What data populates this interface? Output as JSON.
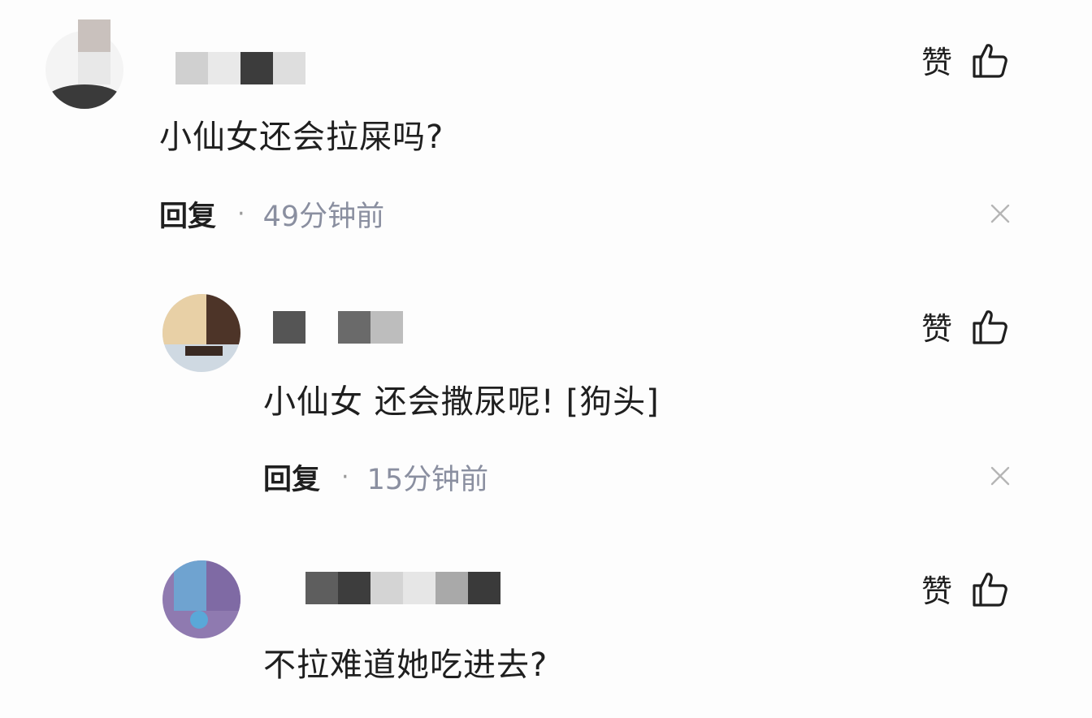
{
  "comments": [
    {
      "text": "小仙女还会拉屎吗?",
      "reply_label": "回复",
      "separator": "·",
      "time": "49分钟前",
      "like_label": "赞"
    },
    {
      "text": "小仙女 还会撒尿呢! [狗头]",
      "reply_label": "回复",
      "separator": "·",
      "time": "15分钟前",
      "like_label": "赞"
    },
    {
      "text": "不拉难道她吃进去?",
      "like_label": "赞"
    }
  ],
  "icons": {
    "like": "thumbs-up-icon",
    "close": "close-icon"
  },
  "colors": {
    "text": "#1f1f1f",
    "time": "#8a8fa0",
    "separator": "#9a9a9a",
    "close": "#b5b5b5"
  }
}
